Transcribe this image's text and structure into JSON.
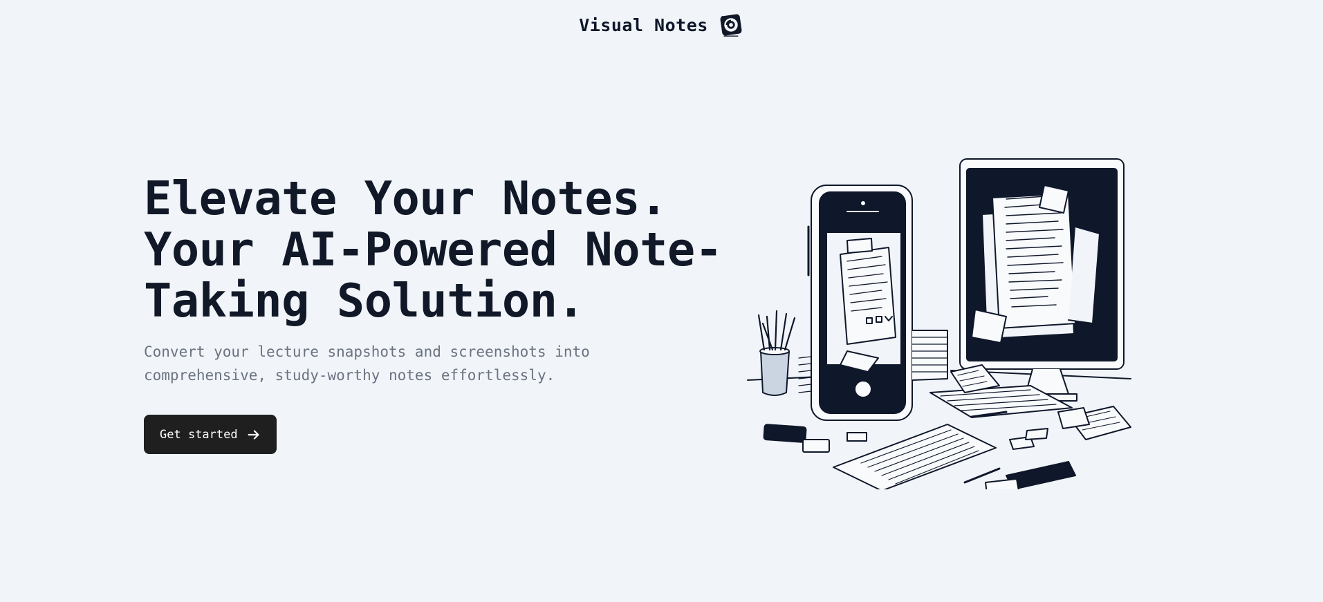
{
  "header": {
    "brand_name": "Visual Notes",
    "logo_icon": "notebook-swirl-icon"
  },
  "hero": {
    "headline_lines": [
      "Elevate Your Notes.",
      "Your AI-Powered Note-",
      "Taking Solution."
    ],
    "subtitle_lines": [
      "Convert your lecture snapshots and screenshots into",
      "comprehensive, study-worthy notes effortlessly."
    ],
    "cta_label": "Get started",
    "cta_icon": "arrow-right-icon"
  },
  "illustration": {
    "description_icon": "desk-devices-notes-illustration"
  },
  "colors": {
    "background": "#f1f5f9",
    "text_primary": "#111827",
    "text_secondary": "#6b7280",
    "button_bg": "#1f1f1f",
    "button_text": "#ffffff"
  }
}
